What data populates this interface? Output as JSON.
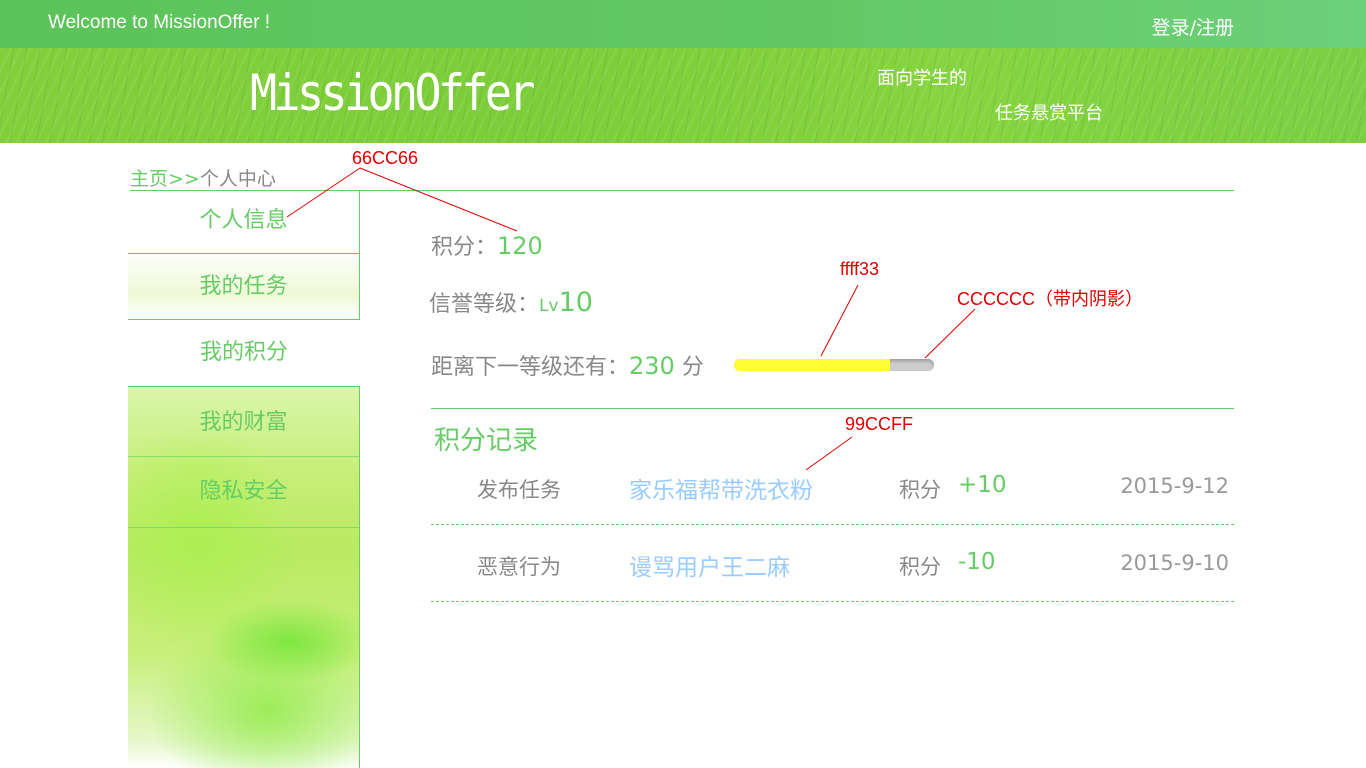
{
  "header": {
    "welcome": "Welcome to MissionOffer !",
    "login_register": "登录/注册"
  },
  "banner": {
    "logo": "MissionOffer",
    "slogan_line1": "面向学生的",
    "slogan_line2": "任务悬赏平台"
  },
  "breadcrumb": {
    "home": "主页",
    "separator": ">>",
    "current": "个人中心"
  },
  "sidebar": {
    "items": [
      {
        "label": "个人信息"
      },
      {
        "label": "我的任务"
      },
      {
        "label": "我的积分"
      },
      {
        "label": "我的财富"
      },
      {
        "label": "隐私安全"
      }
    ],
    "active_index": 2
  },
  "stats": {
    "points_label": "积分：",
    "points_value": "120",
    "level_label": "信誉等级：",
    "level_prefix": "Lv",
    "level_value": "10",
    "next_label": "距离下一等级还有：",
    "next_value": "230",
    "next_unit": " 分",
    "progress_fraction": 0.78
  },
  "records": {
    "title": "积分记录",
    "items": [
      {
        "type": "发布任务",
        "desc": "家乐福帮带洗衣粉",
        "label": "积分",
        "amount": "+10",
        "date": "2015-9-12"
      },
      {
        "type": "恶意行为",
        "desc": "谩骂用户王二麻",
        "label": "积分",
        "amount": "-10",
        "date": "2015-9-10"
      }
    ]
  },
  "annotations": {
    "green": "66CC66",
    "yellow": "ffff33",
    "gray": "CCCCCC（带内阴影）",
    "blue": "99CCFF"
  },
  "colors": {
    "accent_green": "#66cc66",
    "progress_yellow": "#ffff33",
    "progress_track": "#cccccc",
    "link_blue": "#99ccff",
    "annotation_red": "#e00000"
  }
}
